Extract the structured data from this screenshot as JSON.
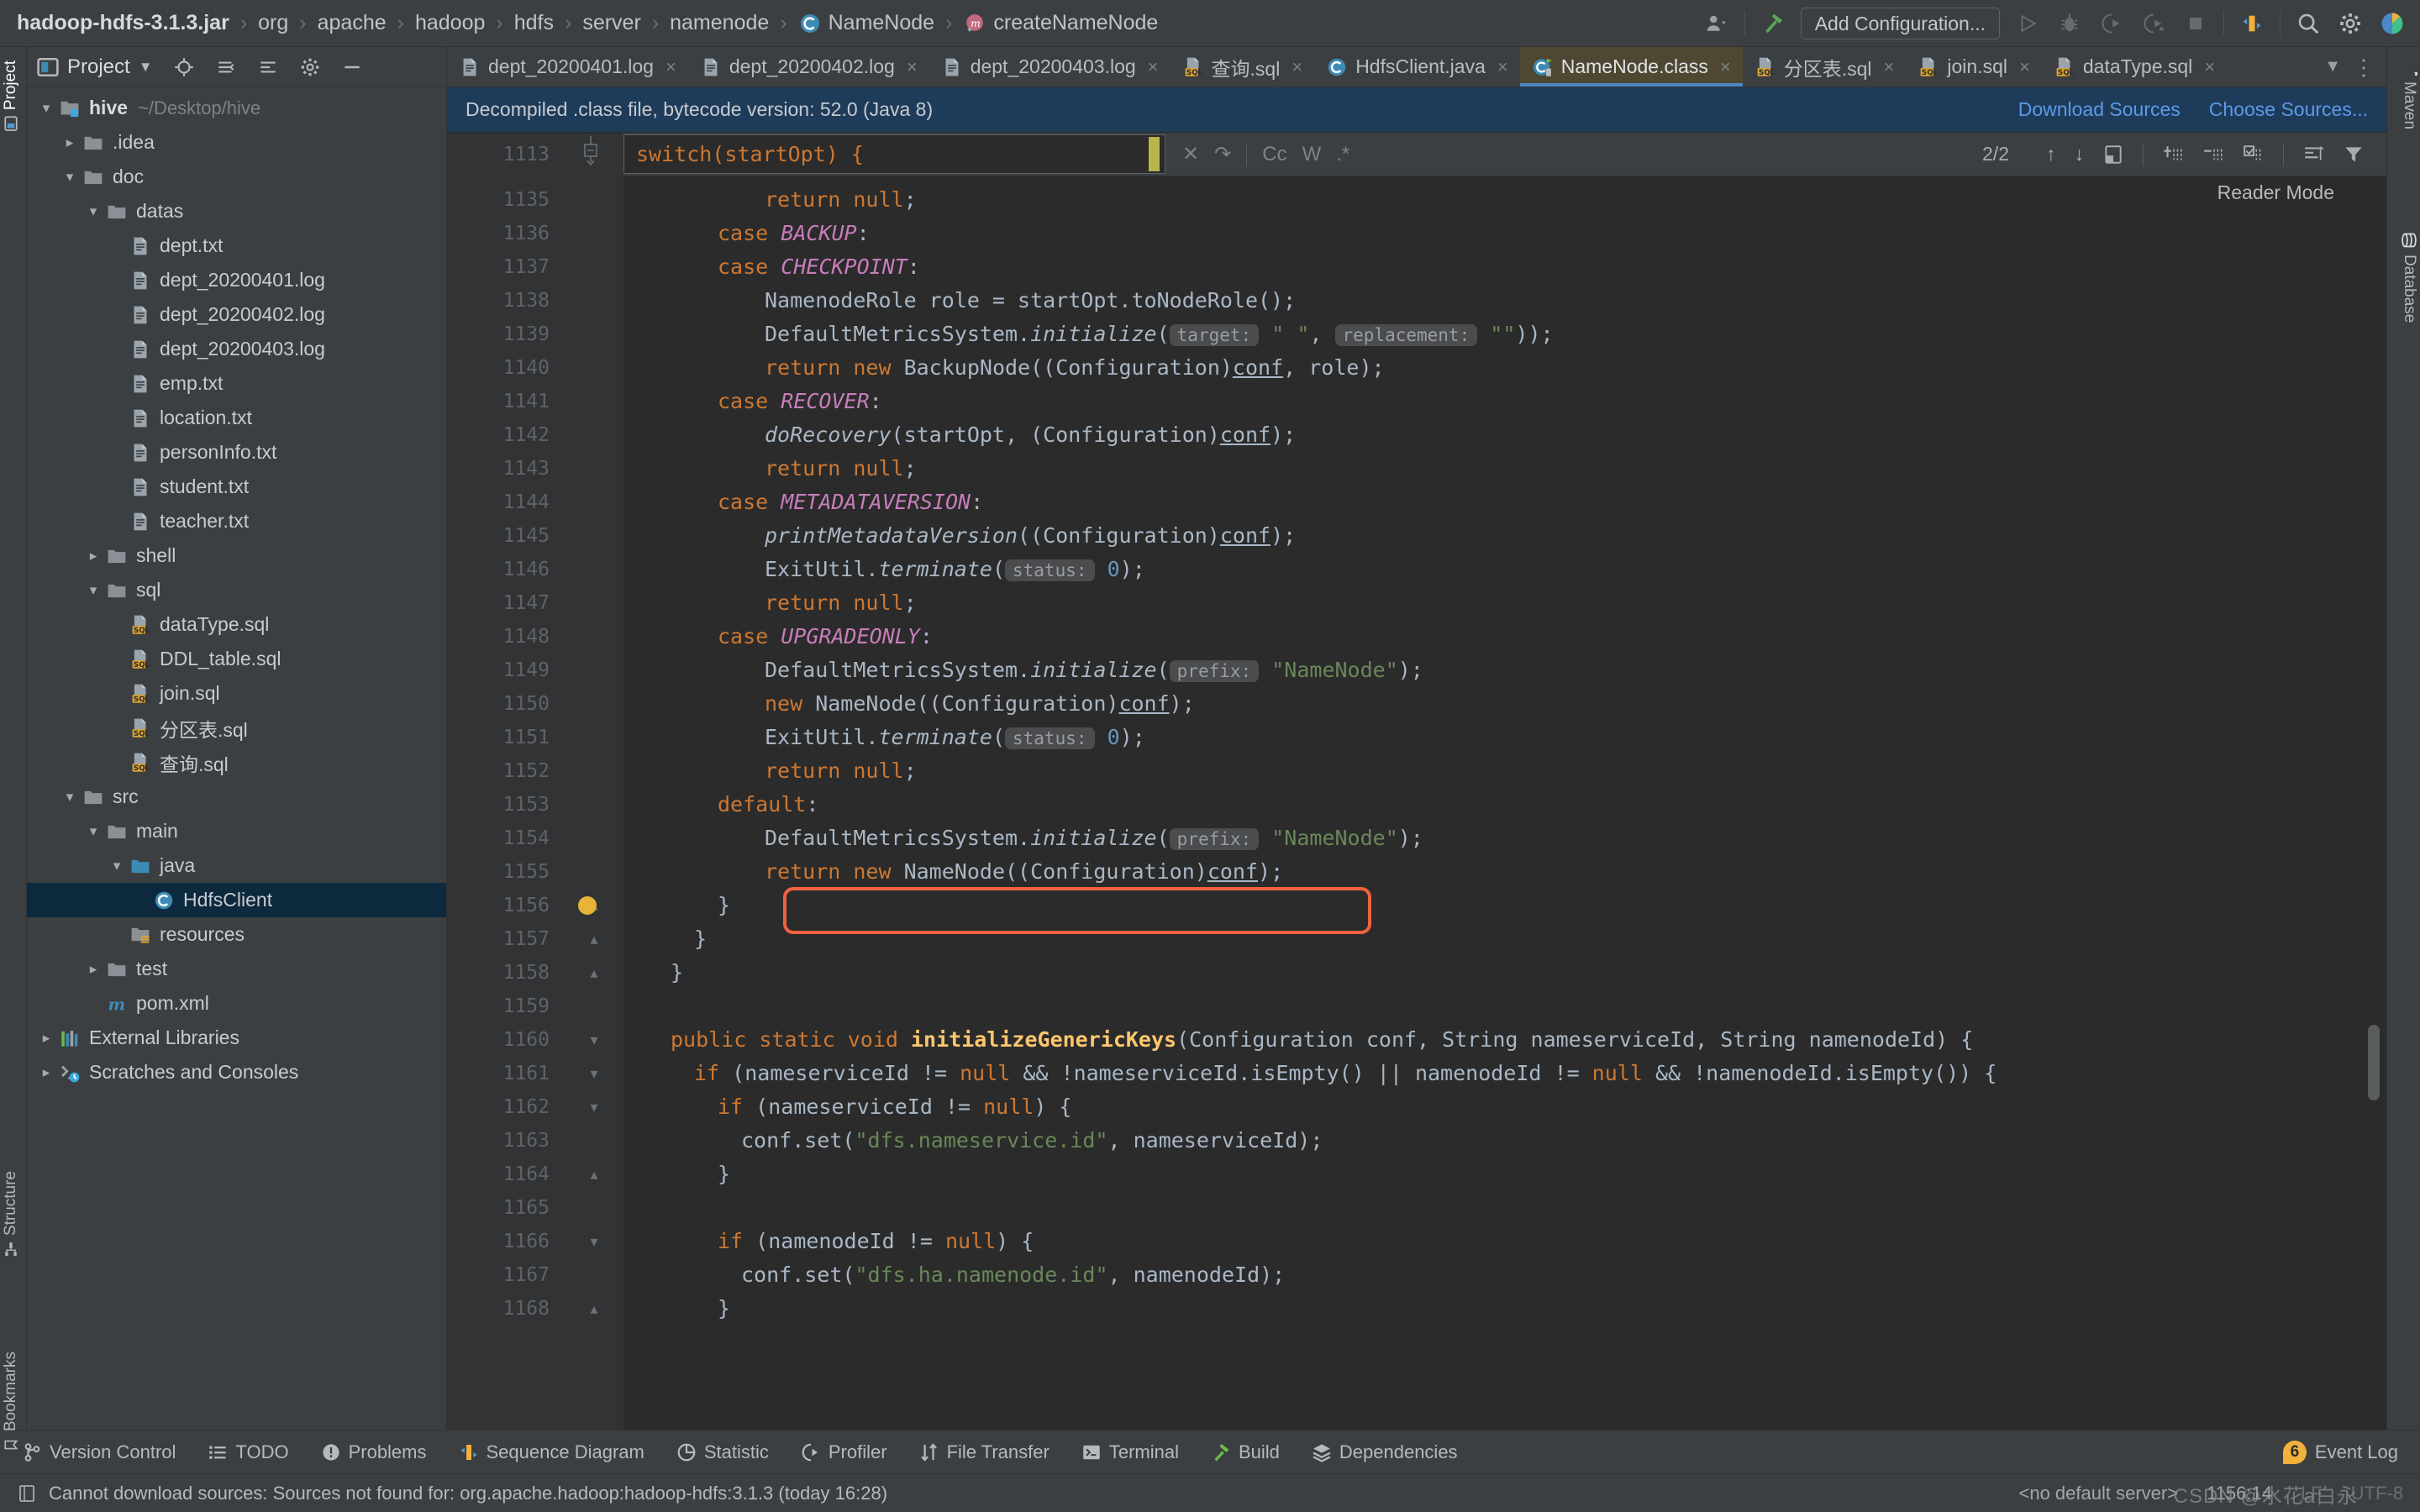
{
  "breadcrumb": {
    "items": [
      {
        "label": "hadoop-hdfs-3.1.3.jar",
        "icon": "jar-file-icon"
      },
      {
        "label": "org",
        "icon": "package-icon"
      },
      {
        "label": "apache",
        "icon": "package-icon"
      },
      {
        "label": "hadoop",
        "icon": "package-icon"
      },
      {
        "label": "hdfs",
        "icon": "package-icon"
      },
      {
        "label": "server",
        "icon": "package-icon"
      },
      {
        "label": "namenode",
        "icon": "package-icon"
      },
      {
        "label": "NameNode",
        "icon": "class-icon"
      },
      {
        "label": "createNameNode",
        "icon": "method-icon"
      }
    ],
    "separator": "›"
  },
  "toolbar": {
    "profile_icon": "user-profile-icon",
    "build_icon": "build-hammer-icon",
    "run_config_label": "Add Configuration...",
    "run_icon": "run-icon",
    "debug_icon": "debug-icon",
    "coverage_icon": "run-with-coverage-icon",
    "profile_run_icon": "profile-icon",
    "stop_icon": "stop-icon",
    "sequence_icon": "sequence-diagram-icon",
    "search_icon": "search-everywhere-icon",
    "settings_icon": "gear-icon",
    "help_icon": "ide-logo-icon"
  },
  "project_panel": {
    "title": "Project",
    "title_icon": "project-view-icon",
    "dropdown_icon": "chevron-down-icon",
    "locate_icon": "target-locate-icon",
    "collapse_icon": "collapse-all-icon",
    "expand_icon": "expand-icon",
    "settings_icon": "gear-icon",
    "hide_icon": "minimize-icon",
    "tree": [
      {
        "label": "hive",
        "sub": "~/Desktop/hive",
        "depth": 0,
        "arrow": "down",
        "icon": "module-folder-icon",
        "bold": true
      },
      {
        "label": ".idea",
        "sub": "",
        "depth": 1,
        "arrow": "right",
        "icon": "folder-icon"
      },
      {
        "label": "doc",
        "sub": "",
        "depth": 1,
        "arrow": "down",
        "icon": "folder-icon"
      },
      {
        "label": "datas",
        "sub": "",
        "depth": 2,
        "arrow": "down",
        "icon": "folder-icon"
      },
      {
        "label": "dept.txt",
        "sub": "",
        "depth": 3,
        "arrow": "none",
        "icon": "text-file-icon"
      },
      {
        "label": "dept_20200401.log",
        "sub": "",
        "depth": 3,
        "arrow": "none",
        "icon": "text-file-icon"
      },
      {
        "label": "dept_20200402.log",
        "sub": "",
        "depth": 3,
        "arrow": "none",
        "icon": "text-file-icon"
      },
      {
        "label": "dept_20200403.log",
        "sub": "",
        "depth": 3,
        "arrow": "none",
        "icon": "text-file-icon"
      },
      {
        "label": "emp.txt",
        "sub": "",
        "depth": 3,
        "arrow": "none",
        "icon": "text-file-icon"
      },
      {
        "label": "location.txt",
        "sub": "",
        "depth": 3,
        "arrow": "none",
        "icon": "text-file-icon"
      },
      {
        "label": "personInfo.txt",
        "sub": "",
        "depth": 3,
        "arrow": "none",
        "icon": "text-file-icon"
      },
      {
        "label": "student.txt",
        "sub": "",
        "depth": 3,
        "arrow": "none",
        "icon": "text-file-icon"
      },
      {
        "label": "teacher.txt",
        "sub": "",
        "depth": 3,
        "arrow": "none",
        "icon": "text-file-icon"
      },
      {
        "label": "shell",
        "sub": "",
        "depth": 2,
        "arrow": "right",
        "icon": "folder-icon"
      },
      {
        "label": "sql",
        "sub": "",
        "depth": 2,
        "arrow": "down",
        "icon": "folder-icon"
      },
      {
        "label": "dataType.sql",
        "sub": "",
        "depth": 3,
        "arrow": "none",
        "icon": "sql-file-icon"
      },
      {
        "label": "DDL_table.sql",
        "sub": "",
        "depth": 3,
        "arrow": "none",
        "icon": "sql-file-icon"
      },
      {
        "label": "join.sql",
        "sub": "",
        "depth": 3,
        "arrow": "none",
        "icon": "sql-file-icon"
      },
      {
        "label": "分区表.sql",
        "sub": "",
        "depth": 3,
        "arrow": "none",
        "icon": "sql-file-icon"
      },
      {
        "label": "查询.sql",
        "sub": "",
        "depth": 3,
        "arrow": "none",
        "icon": "sql-file-icon"
      },
      {
        "label": "src",
        "sub": "",
        "depth": 1,
        "arrow": "down",
        "icon": "folder-icon"
      },
      {
        "label": "main",
        "sub": "",
        "depth": 2,
        "arrow": "down",
        "icon": "folder-icon"
      },
      {
        "label": "java",
        "sub": "",
        "depth": 3,
        "arrow": "down",
        "icon": "source-folder-icon"
      },
      {
        "label": "HdfsClient",
        "sub": "",
        "depth": 4,
        "arrow": "none",
        "icon": "class-icon",
        "selected": true
      },
      {
        "label": "resources",
        "sub": "",
        "depth": 3,
        "arrow": "none",
        "icon": "resources-folder-icon"
      },
      {
        "label": "test",
        "sub": "",
        "depth": 2,
        "arrow": "right",
        "icon": "folder-icon"
      },
      {
        "label": "pom.xml",
        "sub": "",
        "depth": 2,
        "arrow": "none",
        "icon": "maven-pom-icon"
      },
      {
        "label": "External Libraries",
        "sub": "",
        "depth": 0,
        "arrow": "right",
        "icon": "libraries-icon"
      },
      {
        "label": "Scratches and Consoles",
        "sub": "",
        "depth": 0,
        "arrow": "right",
        "icon": "scratches-icon"
      }
    ]
  },
  "editor_tabs": {
    "tabs": [
      {
        "label": "dept_20200401.log",
        "icon": "text-file-icon",
        "active": false
      },
      {
        "label": "dept_20200402.log",
        "icon": "text-file-icon",
        "active": false
      },
      {
        "label": "dept_20200403.log",
        "icon": "text-file-icon",
        "active": false
      },
      {
        "label": "查询.sql",
        "icon": "sql-file-icon",
        "active": false
      },
      {
        "label": "HdfsClient.java",
        "icon": "java-class-icon",
        "active": false
      },
      {
        "label": "NameNode.class",
        "icon": "decompiled-class-icon",
        "active": true
      },
      {
        "label": "分区表.sql",
        "icon": "sql-file-icon",
        "active": false
      },
      {
        "label": "join.sql",
        "icon": "sql-file-icon",
        "active": false
      },
      {
        "label": "dataType.sql",
        "icon": "sql-file-icon",
        "active": false
      }
    ],
    "close_glyph": "×",
    "overflow_icon": "chevron-down-icon",
    "more_icon": "more-options-icon"
  },
  "notification": {
    "message": "Decompiled .class file, bytecode version: 52.0 (Java 8)",
    "download_sources": "Download Sources",
    "choose_sources": "Choose Sources...",
    "close_icon": "close-icon"
  },
  "find_bar": {
    "line_number": "1113",
    "query": "switch(startOpt) {",
    "clear_icon": "close-icon",
    "history_icon": "search-history-icon",
    "match_case": "Cc",
    "words": "W",
    "regex": ".*",
    "match_count": "2/2",
    "prev_icon": "arrow-up-icon",
    "next_icon": "arrow-down-icon",
    "select_all_icon": "select-all-occurrences-icon",
    "add_icon": "add-line-icon",
    "remove_icon": "remove-line-icon",
    "check_icon": "check-lines-icon",
    "indent_icon": "indent-icon",
    "filter_icon": "filter-icon"
  },
  "reader_mode": "Reader Mode",
  "code": {
    "first_line": 1135,
    "lines": [
      {
        "n": 1135,
        "fold": "",
        "indent": 6,
        "html": "<span class=\"kw\">return</span> <span class=\"kw\">null</span>;"
      },
      {
        "n": 1136,
        "fold": "",
        "indent": 4,
        "html": "<span class=\"kw\">case</span> <span class=\"enumc\">BACKUP</span>:"
      },
      {
        "n": 1137,
        "fold": "",
        "indent": 4,
        "html": "<span class=\"kw\">case</span> <span class=\"enumc\">CHECKPOINT</span>:"
      },
      {
        "n": 1138,
        "fold": "",
        "indent": 6,
        "html": "NamenodeRole role = startOpt.toNodeRole();"
      },
      {
        "n": 1139,
        "fold": "",
        "indent": 6,
        "html": "DefaultMetricsSystem.<span class=\"mth\">initialize</span>(<span class=\"hint\">target:</span> <span class=\"str\">\" \"</span>, <span class=\"hint\">replacement:</span> <span class=\"str\">\"\"</span>));"
      },
      {
        "n": 1140,
        "fold": "",
        "indent": 6,
        "html": "<span class=\"kw\">return</span> <span class=\"kw\">new</span> BackupNode((Configuration)<span class=\"under\">conf</span>, role);"
      },
      {
        "n": 1141,
        "fold": "",
        "indent": 4,
        "html": "<span class=\"kw\">case</span> <span class=\"enumc\">RECOVER</span>:"
      },
      {
        "n": 1142,
        "fold": "",
        "indent": 6,
        "html": "<span class=\"mth\">doRecovery</span>(startOpt, (Configuration)<span class=\"under\">conf</span>);"
      },
      {
        "n": 1143,
        "fold": "",
        "indent": 6,
        "html": "<span class=\"kw\">return</span> <span class=\"kw\">null</span>;"
      },
      {
        "n": 1144,
        "fold": "",
        "indent": 4,
        "html": "<span class=\"kw\">case</span> <span class=\"enumc\">METADATAVERSION</span>:"
      },
      {
        "n": 1145,
        "fold": "",
        "indent": 6,
        "html": "<span class=\"mth\">printMetadataVersion</span>((Configuration)<span class=\"under\">conf</span>);"
      },
      {
        "n": 1146,
        "fold": "",
        "indent": 6,
        "html": "ExitUtil.<span class=\"mth\">terminate</span>(<span class=\"hint\">status:</span> <span class=\"num\">0</span>);"
      },
      {
        "n": 1147,
        "fold": "",
        "indent": 6,
        "html": "<span class=\"kw\">return</span> <span class=\"kw\">null</span>;"
      },
      {
        "n": 1148,
        "fold": "",
        "indent": 4,
        "html": "<span class=\"kw\">case</span> <span class=\"enumc\">UPGRADEONLY</span>:"
      },
      {
        "n": 1149,
        "fold": "",
        "indent": 6,
        "html": "DefaultMetricsSystem.<span class=\"mth\">initialize</span>(<span class=\"hint\">prefix:</span> <span class=\"str\">\"NameNode\"</span>);"
      },
      {
        "n": 1150,
        "fold": "",
        "indent": 6,
        "html": "<span class=\"kw\">new</span> NameNode((Configuration)<span class=\"under\">conf</span>);"
      },
      {
        "n": 1151,
        "fold": "",
        "indent": 6,
        "html": "ExitUtil.<span class=\"mth\">terminate</span>(<span class=\"hint\">status:</span> <span class=\"num\">0</span>);"
      },
      {
        "n": 1152,
        "fold": "",
        "indent": 6,
        "html": "<span class=\"kw\">return</span> <span class=\"kw\">null</span>;"
      },
      {
        "n": 1153,
        "fold": "",
        "indent": 4,
        "html": "<span class=\"kw\">default</span>:"
      },
      {
        "n": 1154,
        "fold": "",
        "indent": 6,
        "html": "DefaultMetricsSystem.<span class=\"mth\">initialize</span>(<span class=\"hint\">prefix:</span> <span class=\"str\">\"NameNode\"</span>);"
      },
      {
        "n": 1155,
        "fold": "",
        "indent": 6,
        "html": "<span class=\"kw\">return</span> <span class=\"kw\">new</span> NameNode((Configuration)<span class=\"under\">conf</span>);"
      },
      {
        "n": 1156,
        "fold": "end",
        "indent": 4,
        "html": "}"
      },
      {
        "n": 1157,
        "fold": "end",
        "indent": 3,
        "html": "}"
      },
      {
        "n": 1158,
        "fold": "end",
        "indent": 2,
        "html": "}"
      },
      {
        "n": 1159,
        "fold": "",
        "indent": 0,
        "html": ""
      },
      {
        "n": 1160,
        "fold": "start",
        "indent": 2,
        "html": "<span class=\"kw\">public static void</span> <span class=\"bold\" style=\"color:#ffc66d\">initializeGenericKeys</span>(Configuration conf, String nameserviceId, String namenodeId) {"
      },
      {
        "n": 1161,
        "fold": "start",
        "indent": 3,
        "html": "<span class=\"kw\">if</span> (nameserviceId != <span class=\"kw\">null</span> &amp;&amp; !nameserviceId.isEmpty() || namenodeId != <span class=\"kw\">null</span> &amp;&amp; !namenodeId.isEmpty()) {"
      },
      {
        "n": 1162,
        "fold": "start",
        "indent": 4,
        "html": "<span class=\"kw\">if</span> (nameserviceId != <span class=\"kw\">null</span>) {"
      },
      {
        "n": 1163,
        "fold": "",
        "indent": 5,
        "html": "conf.set(<span class=\"str\">\"dfs.nameservice.id\"</span>, nameserviceId);"
      },
      {
        "n": 1164,
        "fold": "end",
        "indent": 4,
        "html": "}"
      },
      {
        "n": 1165,
        "fold": "",
        "indent": 0,
        "html": ""
      },
      {
        "n": 1166,
        "fold": "start",
        "indent": 4,
        "html": "<span class=\"kw\">if</span> (namenodeId != <span class=\"kw\">null</span>) {"
      },
      {
        "n": 1167,
        "fold": "",
        "indent": 5,
        "html": "conf.set(<span class=\"str\">\"dfs.ha.namenode.id\"</span>, namenodeId);"
      },
      {
        "n": 1168,
        "fold": "end",
        "indent": 4,
        "html": "}"
      }
    ],
    "annotation_marker": "@",
    "bulb_icon": "intention-bulb-icon"
  },
  "left_tool_tabs": [
    {
      "label": "Project",
      "icon": "project-icon",
      "selected": true
    },
    {
      "label": "Structure",
      "icon": "structure-icon",
      "selected": false
    },
    {
      "label": "Bookmarks",
      "icon": "bookmarks-icon",
      "selected": false
    }
  ],
  "right_tool_tabs": [
    {
      "label": "Maven",
      "icon": "maven-icon"
    },
    {
      "label": "Database",
      "icon": "database-icon"
    }
  ],
  "tool_windows": {
    "items": [
      {
        "label": "Version Control",
        "icon": "branch-icon"
      },
      {
        "label": "TODO",
        "icon": "todo-list-icon"
      },
      {
        "label": "Problems",
        "icon": "problems-icon"
      },
      {
        "label": "Sequence Diagram",
        "icon": "sequence-diagram-icon"
      },
      {
        "label": "Statistic",
        "icon": "statistic-icon"
      },
      {
        "label": "Profiler",
        "icon": "profiler-icon"
      },
      {
        "label": "File Transfer",
        "icon": "file-transfer-icon"
      },
      {
        "label": "Terminal",
        "icon": "terminal-icon"
      },
      {
        "label": "Build",
        "icon": "build-icon"
      },
      {
        "label": "Dependencies",
        "icon": "dependencies-icon"
      }
    ],
    "event_log": "Event Log",
    "event_log_badge": "6",
    "event_log_icon": "event-log-icon"
  },
  "status_bar": {
    "message_icon": "notification-icon",
    "message": "Cannot download sources: Sources not found for: org.apache.hadoop:hadoop-hdfs:3.1.3 (today 16:28)",
    "server": "<no default server>",
    "caret": "1156:14",
    "line_sep": "LF",
    "encoding": "UTF-8",
    "watermark": "CSDN @水花a白永"
  },
  "colors": {
    "accent_blue": "#4a88c7",
    "highlight_orange": "#f2613f",
    "active_tab_bg": "#4e4832",
    "notification_bg": "#1e3c5a",
    "selection_blue": "#0d293e",
    "editor_bg": "#2b2b2b",
    "panel_bg": "#3c3f41",
    "gutter_bg": "#313335",
    "sql_icon": "#d9a334"
  }
}
